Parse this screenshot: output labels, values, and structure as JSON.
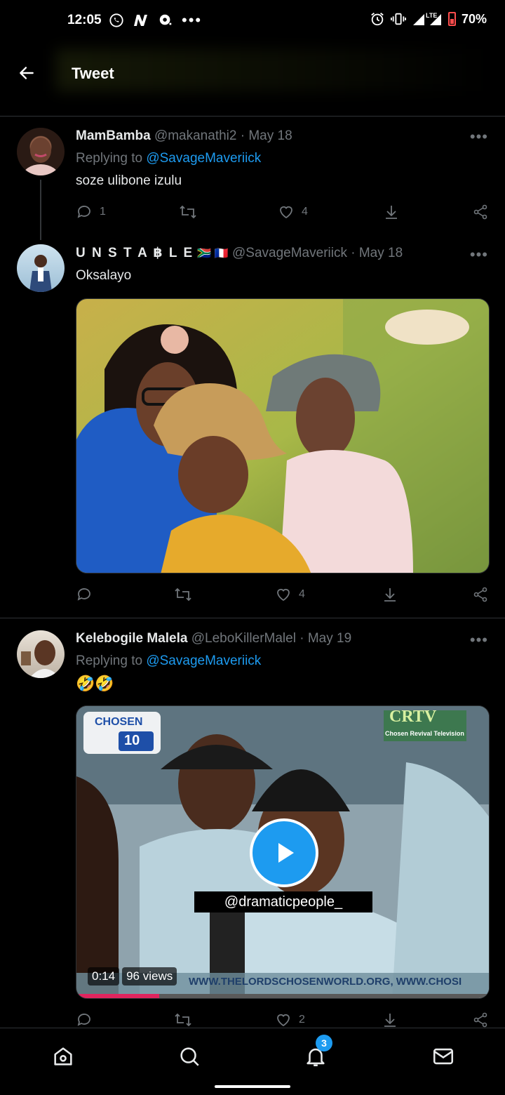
{
  "status_bar": {
    "time": "12:05",
    "battery": "70%",
    "network": "LTE",
    "icons_left": [
      "whatsapp-icon",
      "n-app-icon",
      "chat-icon",
      "more-dots-icon"
    ],
    "icons_right": [
      "alarm-icon",
      "vibrate-icon",
      "signal-icon",
      "battery-icon"
    ]
  },
  "header": {
    "title": "Tweet"
  },
  "tweets": [
    {
      "name": "MamBamba",
      "handle": "@makanathi2",
      "date": "· May 18",
      "replying_prefix": "Replying to ",
      "replying_to": "@SavageMaveriick",
      "text": "soze ulibone izulu",
      "replies": "1",
      "retweets": "",
      "likes": "4"
    },
    {
      "name": "U N S T A ฿ L E",
      "name_flags": "🇿🇦 🇫🇷",
      "handle": "@SavageMaveriick",
      "date": "· May 18",
      "text": "Oksalayo",
      "replies": "",
      "retweets": "",
      "likes": "4"
    },
    {
      "name": "Kelebogile Malela",
      "handle": "@LeboKillerMalel",
      "date": "· May 19",
      "replying_prefix": "Replying to ",
      "replying_to": "@SavageMaveriick",
      "text": "🤣🤣",
      "video": {
        "watermark": "@dramaticpeople_",
        "logo_text": "CHOSEN",
        "logo_num": "10",
        "channel": "CRTV",
        "channel_sub": "Chosen Revival Television",
        "ticker": "WWW.THELORDSCHOSENWORLD.ORG, WWW.CHOSI",
        "time": "0:14",
        "views": "96 views",
        "progress": 0.2
      },
      "replies": "",
      "retweets": "",
      "likes": "2"
    }
  ],
  "bottom_nav": {
    "items": [
      "home-icon",
      "search-icon",
      "notifications-icon",
      "messages-icon"
    ],
    "notification_count": "3"
  },
  "colors": {
    "link": "#1d9bf0",
    "muted": "#71767b",
    "bg": "#000000"
  }
}
